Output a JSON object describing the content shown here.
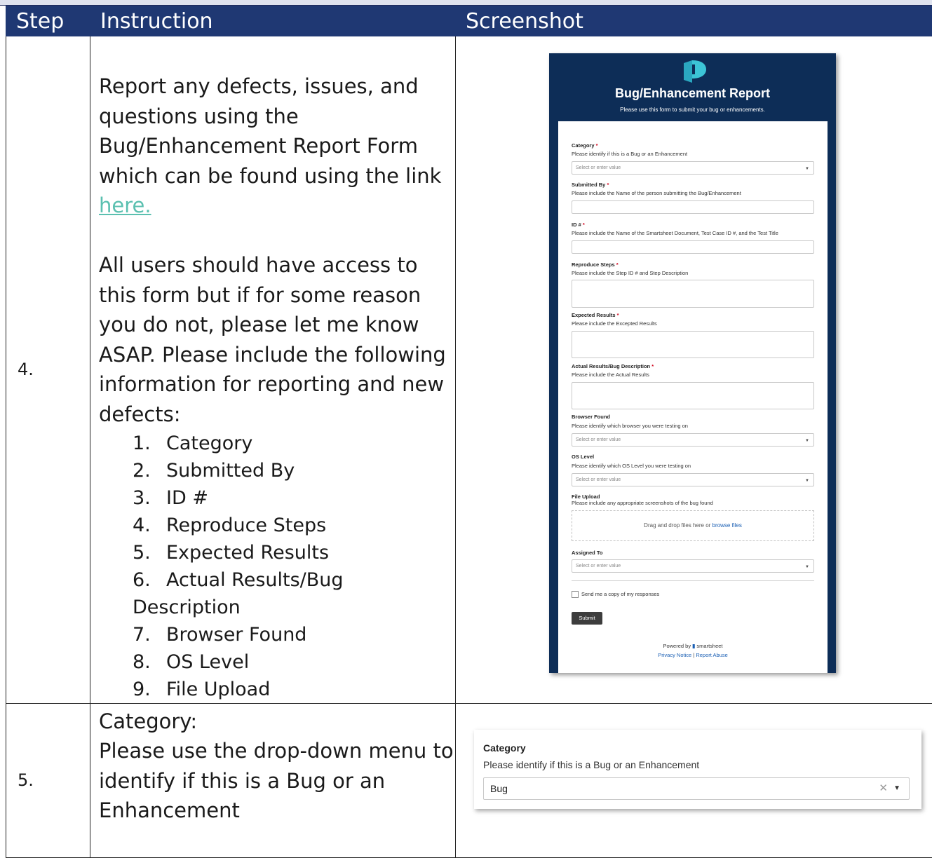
{
  "table": {
    "headers": [
      "Step",
      "Instruction",
      "Screenshot"
    ],
    "rows": [
      {
        "step": "4.",
        "intro": "Report any defects, issues, and questions using the Bug/Enhancement Report Form which can be found using the link",
        "link_text": "here.",
        "access_note": "All users should have access to this form but if for some reason you do not, please let me know ASAP. Please include the following information for reporting and new defects:",
        "list": [
          {
            "n": "1.",
            "t": "Category"
          },
          {
            "n": "2.",
            "t": "Submitted By"
          },
          {
            "n": "3.",
            "t": "ID #"
          },
          {
            "n": "4.",
            "t": "Reproduce Steps"
          },
          {
            "n": "5.",
            "t": "Expected Results"
          },
          {
            "n": "6.",
            "t": "Actual Results/Bug Description"
          },
          {
            "n": "7.",
            "t": "Browser Found"
          },
          {
            "n": "8.",
            "t": "OS Level"
          },
          {
            "n": "9.",
            "t": "File Upload"
          }
        ]
      },
      {
        "step": "5.",
        "title": "Category:",
        "text": "Please use the drop-down menu to identify if this is a Bug or an Enhancement"
      }
    ]
  },
  "form": {
    "title": "Bug/Enhancement Report",
    "subtitle": "Please use this form to submit your bug or enhancements.",
    "fields": {
      "category": {
        "label": "Category",
        "hint": "Please identify if this is a Bug or an Enhancement",
        "placeholder": "Select or enter value"
      },
      "submitted_by": {
        "label": "Submitted By",
        "hint": "Please include the Name of the person submitting the Bug/Enhancement"
      },
      "id": {
        "label": "ID #",
        "hint": "Please include the Name of the Smartsheet Document, Test Case ID #, and the Test Title"
      },
      "reproduce": {
        "label": "Reproduce Steps",
        "hint": "Please include the Step ID # and Step Description"
      },
      "expected": {
        "label": "Expected Results",
        "hint": "Please include the Excepted Results"
      },
      "actual": {
        "label": "Actual Results/Bug Description",
        "hint": "Please include the Actual Results"
      },
      "browser": {
        "label": "Browser Found",
        "hint": "Please identify which browser you were testing on",
        "placeholder": "Select or enter value"
      },
      "os": {
        "label": "OS Level",
        "hint": "Please identify which OS Level you were testing on",
        "placeholder": "Select or enter value"
      },
      "upload": {
        "label": "File Upload",
        "hint": "Please include any appropriate screenshots of the bug found",
        "drop_text": "Drag and drop files here or",
        "browse": "browse files"
      },
      "assigned": {
        "label": "Assigned To",
        "placeholder": "Select or enter value"
      }
    },
    "required_mark": "*",
    "copy_checkbox": "Send me a copy of my responses",
    "submit": "Submit",
    "powered_by": "Powered by",
    "brand": "smartsheet",
    "privacy": "Privacy Notice",
    "divider": "|",
    "report_abuse": "Report Abuse",
    "colors": {
      "header_bg": "#0d2d57",
      "logo": "#2bb4c6"
    }
  },
  "category_crop": {
    "label": "Category",
    "hint": "Please identify if this is a Bug or an Enhancement",
    "value": "Bug",
    "clear_icon": "close-icon",
    "caret_icon": "caret-down-icon"
  },
  "colors": {
    "header_bg": "#1f3873",
    "link": "#5bc0b0"
  }
}
